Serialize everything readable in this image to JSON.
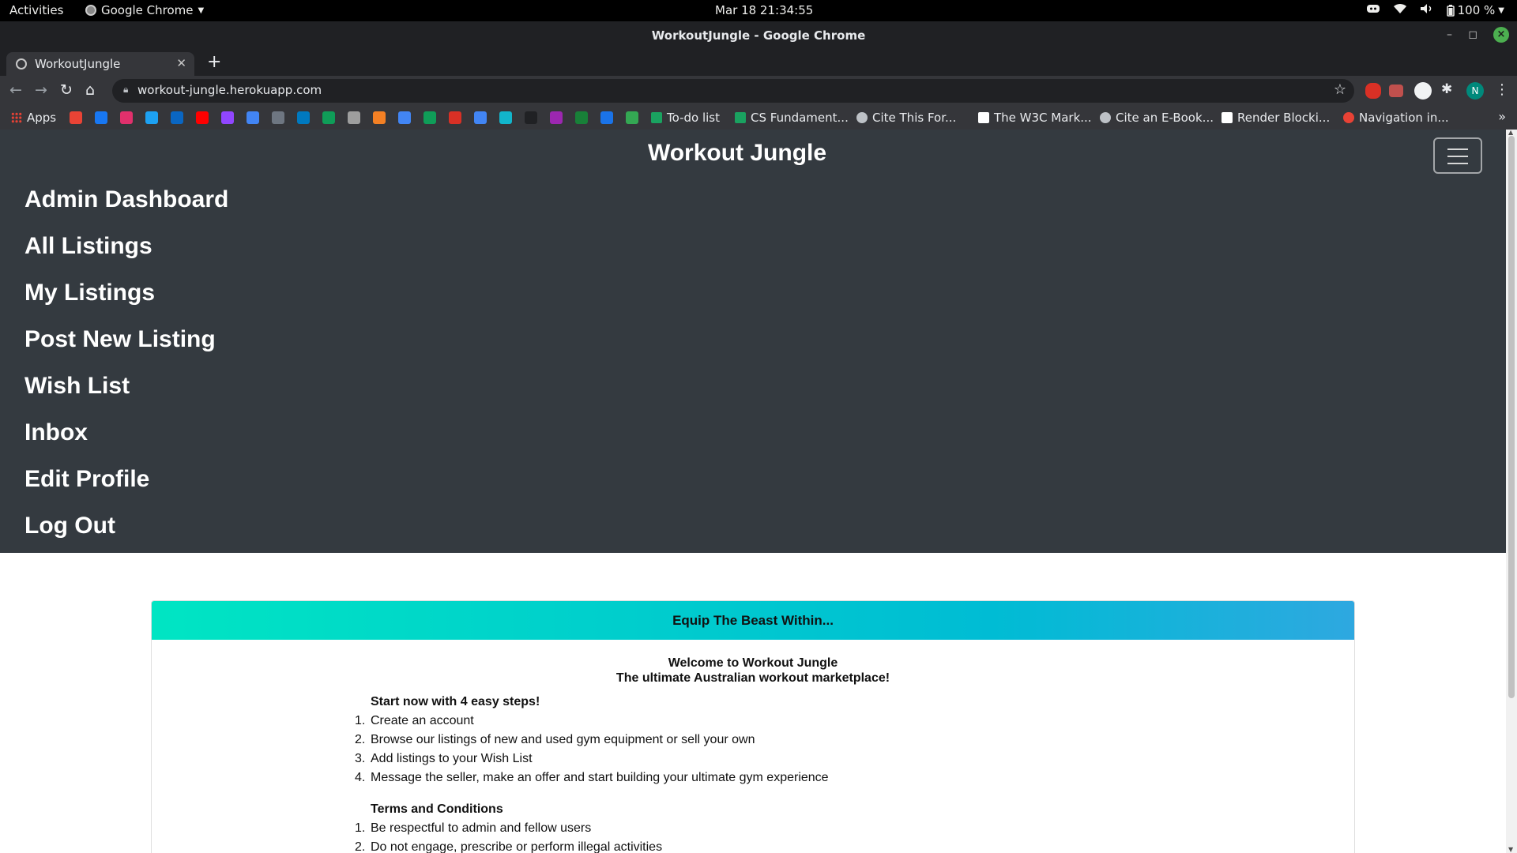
{
  "os_bar": {
    "activities": "Activities",
    "app_name": "Google Chrome",
    "clock": "Mar 18  21:34:55",
    "battery": "100 %"
  },
  "browser": {
    "window_title": "WorkoutJungle - Google Chrome",
    "tab_title": "WorkoutJungle",
    "url": "workout-jungle.herokuapp.com",
    "profile_initial": "N",
    "bookmarks": {
      "apps_label": "Apps",
      "icon_bookmarks": [
        "gmail",
        "facebook",
        "instagram",
        "twitter",
        "linkedin",
        "youtube",
        "twitch",
        "calendar",
        "github",
        "trello",
        "drive-b",
        "notes",
        "stackoverflow",
        "docs-blue",
        "sheets",
        "slides-red",
        "docs",
        "colab",
        "unsplash",
        "feather",
        "edu",
        "cloud",
        "shield"
      ],
      "named": [
        "To-do list",
        "CS Fundament...",
        "Cite This For...",
        "The W3C Mark...",
        "Cite an E-Book...",
        "Render Blocki...",
        "Navigation in..."
      ]
    }
  },
  "site": {
    "brand": "Workout Jungle",
    "nav_items": [
      "Admin Dashboard",
      "All Listings",
      "My Listings",
      "Post New Listing",
      "Wish List",
      "Inbox",
      "Edit Profile",
      "Log Out"
    ],
    "card": {
      "header": "Equip The Beast Within...",
      "welcome_line1": "Welcome to Workout Jungle",
      "welcome_line2": "The ultimate Australian workout marketplace!",
      "steps_title": "Start now with 4 easy steps!",
      "steps": [
        "Create an account",
        "Browse our listings of new and used gym equipment or sell your own",
        "Add listings to your Wish List",
        "Message the seller, make an offer and start building your ultimate gym experience"
      ],
      "terms_title": "Terms and Conditions",
      "terms": [
        "Be respectful to admin and fellow users",
        "Do not engage, prescribe or perform illegal activities"
      ]
    }
  },
  "colors": {
    "navbar_bg": "#343a40",
    "header_gradient_start": "#00e5c3",
    "header_gradient_end": "#2ea8e0"
  }
}
